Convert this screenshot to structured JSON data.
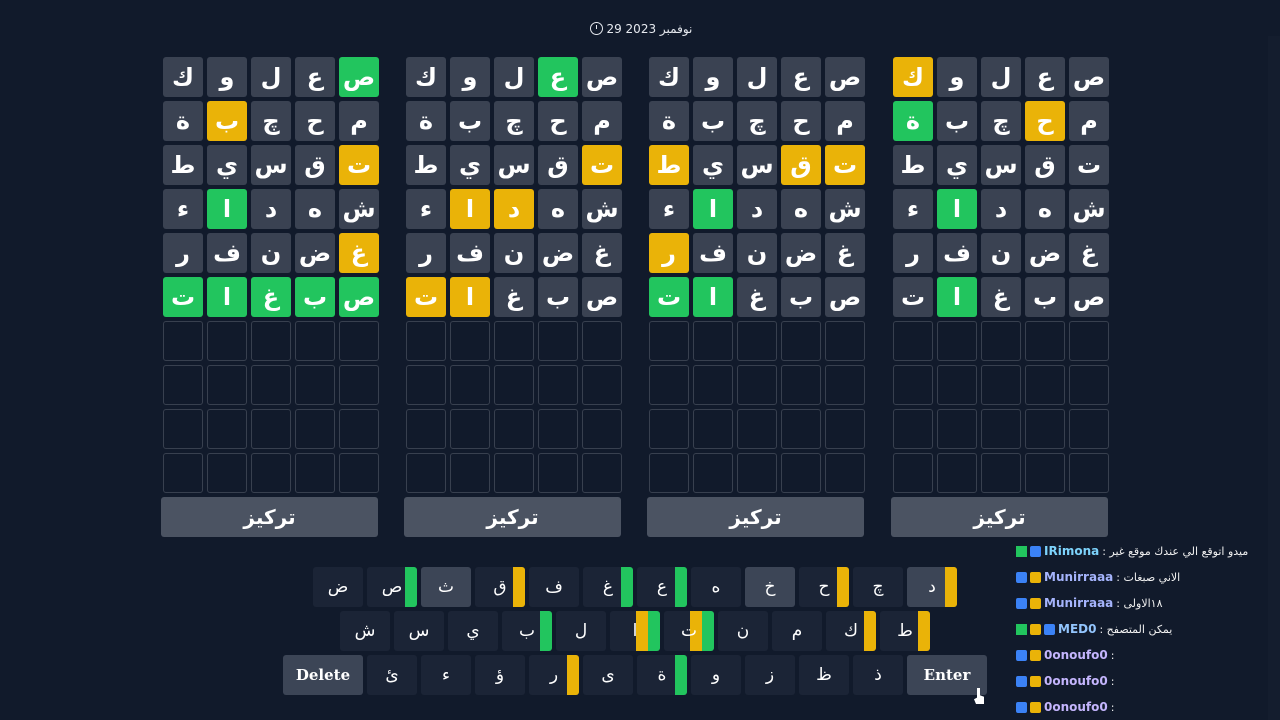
{
  "date": "29 نوفمبر 2023",
  "focus_label": "تركيز",
  "colors": {
    "green": "#22c55e",
    "yellow": "#eab308",
    "cell": "#3a4252",
    "background": "#111a2b"
  },
  "guesses": [
    [
      "ص",
      "ع",
      "ل",
      "و",
      "ك"
    ],
    [
      "م",
      "ح",
      "چ",
      "ب",
      "ة"
    ],
    [
      "ت",
      "ق",
      "س",
      "ي",
      "ط"
    ],
    [
      "ش",
      "ه",
      "د",
      "ا",
      "ء"
    ],
    [
      "غ",
      "ض",
      "ن",
      "ف",
      "ر"
    ],
    [
      "ص",
      "ب",
      "غ",
      "ا",
      "ت"
    ]
  ],
  "boards": [
    {
      "states": [
        [
          "-",
          "-",
          "-",
          "-",
          "y"
        ],
        [
          "-",
          "y",
          "-",
          "-",
          "g"
        ],
        [
          "-",
          "-",
          "-",
          "-",
          "-"
        ],
        [
          "-",
          "-",
          "-",
          "g",
          "-"
        ],
        [
          "-",
          "-",
          "-",
          "-",
          "-"
        ],
        [
          "-",
          "-",
          "-",
          "g",
          "-"
        ]
      ]
    },
    {
      "states": [
        [
          "-",
          "-",
          "-",
          "-",
          "-"
        ],
        [
          "-",
          "-",
          "-",
          "-",
          "-"
        ],
        [
          "y",
          "y",
          "-",
          "-",
          "y"
        ],
        [
          "-",
          "-",
          "-",
          "g",
          "-"
        ],
        [
          "-",
          "-",
          "-",
          "-",
          "y"
        ],
        [
          "-",
          "-",
          "-",
          "g",
          "g"
        ]
      ]
    },
    {
      "states": [
        [
          "-",
          "g",
          "-",
          "-",
          "-"
        ],
        [
          "-",
          "-",
          "-",
          "-",
          "-"
        ],
        [
          "y",
          "-",
          "-",
          "-",
          "-"
        ],
        [
          "-",
          "-",
          "y",
          "y",
          "-"
        ],
        [
          "-",
          "-",
          "-",
          "-",
          "-"
        ],
        [
          "-",
          "-",
          "-",
          "y",
          "y"
        ]
      ]
    },
    {
      "states": [
        [
          "g",
          "-",
          "-",
          "-",
          "-"
        ],
        [
          "-",
          "-",
          "-",
          "y",
          "-"
        ],
        [
          "y",
          "-",
          "-",
          "-",
          "-"
        ],
        [
          "-",
          "-",
          "-",
          "g",
          "-"
        ],
        [
          "y",
          "-",
          "-",
          "-",
          "-"
        ],
        [
          "g",
          "g",
          "g",
          "g",
          "g"
        ]
      ]
    }
  ],
  "keyboard": {
    "rows": [
      [
        {
          "k": "د",
          "s": "d",
          "bars": [
            "y"
          ]
        },
        {
          "k": "چ"
        },
        {
          "k": "ح",
          "bars": [
            "y"
          ]
        },
        {
          "k": "خ",
          "s": "d"
        },
        {
          "k": "ه"
        },
        {
          "k": "ع",
          "bars": [
            "g"
          ]
        },
        {
          "k": "غ",
          "bars": [
            "g"
          ]
        },
        {
          "k": "ف"
        },
        {
          "k": "ق",
          "bars": [
            "y"
          ]
        },
        {
          "k": "ث",
          "s": "d"
        },
        {
          "k": "ص",
          "bars": [
            "g"
          ]
        },
        {
          "k": "ض"
        }
      ],
      [
        {
          "k": "ط",
          "bars": [
            "y"
          ]
        },
        {
          "k": "ك",
          "bars": [
            "y"
          ]
        },
        {
          "k": "م"
        },
        {
          "k": "ن"
        },
        {
          "k": "ت",
          "bars": [
            "g",
            "y"
          ]
        },
        {
          "k": "ا",
          "bars": [
            "g",
            "y"
          ]
        },
        {
          "k": "ل"
        },
        {
          "k": "ب",
          "bars": [
            "g"
          ]
        },
        {
          "k": "ي"
        },
        {
          "k": "س"
        },
        {
          "k": "ش"
        }
      ],
      [
        {
          "k": "Enter",
          "w": true
        },
        {
          "k": "ذ"
        },
        {
          "k": "ظ"
        },
        {
          "k": "ز"
        },
        {
          "k": "و"
        },
        {
          "k": "ة",
          "bars": [
            "g"
          ]
        },
        {
          "k": "ى"
        },
        {
          "k": "ر",
          "bars": [
            "y"
          ]
        },
        {
          "k": "ؤ"
        },
        {
          "k": "ء"
        },
        {
          "k": "ئ"
        },
        {
          "k": "Delete",
          "w": true
        }
      ]
    ]
  },
  "chat": [
    {
      "user": "IRimona",
      "text": ": ميدو اتوقع الي عندك موقع غير",
      "color": "#7dd3fc",
      "badges": [
        "b3",
        "b1"
      ]
    },
    {
      "user": "Munirraaa",
      "text": ": الاني صبغات",
      "color": "#a5b4fc",
      "badges": [
        "b1",
        "b2"
      ]
    },
    {
      "user": "Munirraaa",
      "text": ": ١٨الاولى",
      "color": "#a5b4fc",
      "badges": [
        "b1",
        "b2"
      ]
    },
    {
      "user": "MED0",
      "text": ": يمكن المتصفح",
      "color": "#93c5fd",
      "badges": [
        "b3",
        "b2",
        "b1"
      ]
    },
    {
      "user": "0onoufo0",
      "text": ":",
      "color": "#c4b5fd",
      "badges": [
        "b1",
        "b2"
      ]
    },
    {
      "user": "0onoufo0",
      "text": ":",
      "color": "#c4b5fd",
      "badges": [
        "b1",
        "b2"
      ]
    },
    {
      "user": "0onoufo0",
      "text": ":",
      "color": "#c4b5fd",
      "badges": [
        "b1",
        "b2"
      ]
    }
  ]
}
